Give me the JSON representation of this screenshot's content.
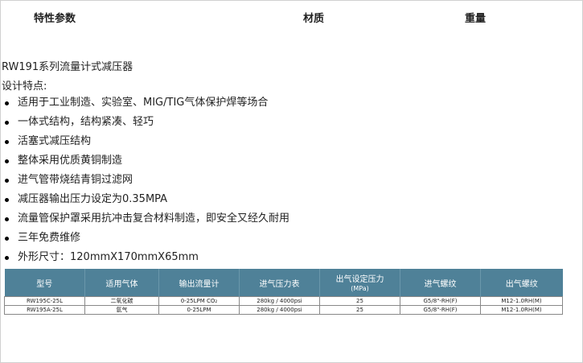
{
  "header": {
    "params_label": "特性参数",
    "material_label": "材质",
    "weight_label": "重量"
  },
  "product": {
    "title": "RW191系列流量计式减压器",
    "features_label": "设计特点:",
    "features": [
      "适用于工业制造、实验室、MIG/TIG气体保护焊等场合",
      "一体式结构，结构紧凑、轻巧",
      "活塞式减压结构",
      "整体采用优质黄铜制造",
      "进气管带烧结青铜过滤网",
      "减压器输出压力设定为0.35MPA",
      "流量管保护罩采用抗冲击复合材料制造，即安全又经久耐用",
      "三年免费维修",
      "外形尺寸：120mmX170mmX65mm"
    ]
  },
  "spec_table": {
    "columns": [
      {
        "label": "型号",
        "sub": ""
      },
      {
        "label": "适用气体",
        "sub": ""
      },
      {
        "label": "输出流量计",
        "sub": ""
      },
      {
        "label": "进气压力表",
        "sub": ""
      },
      {
        "label": "出气设定压力",
        "sub": "(MPa)"
      },
      {
        "label": "进气螺纹",
        "sub": ""
      },
      {
        "label": "出气螺纹",
        "sub": ""
      }
    ],
    "rows": [
      [
        "RW195C-25L",
        "二氧化碳",
        "0-25LPM CO₂",
        "280kg / 4000psi",
        "25",
        "G5/8\"-RH(F)",
        "M12-1.0RH(M)"
      ],
      [
        "RW195A-25L",
        "氩气",
        "0-25LPM",
        "280kg / 4000psi",
        "25",
        "G5/8\"-RH(F)",
        "M12-1.0RH(M)"
      ]
    ]
  }
}
